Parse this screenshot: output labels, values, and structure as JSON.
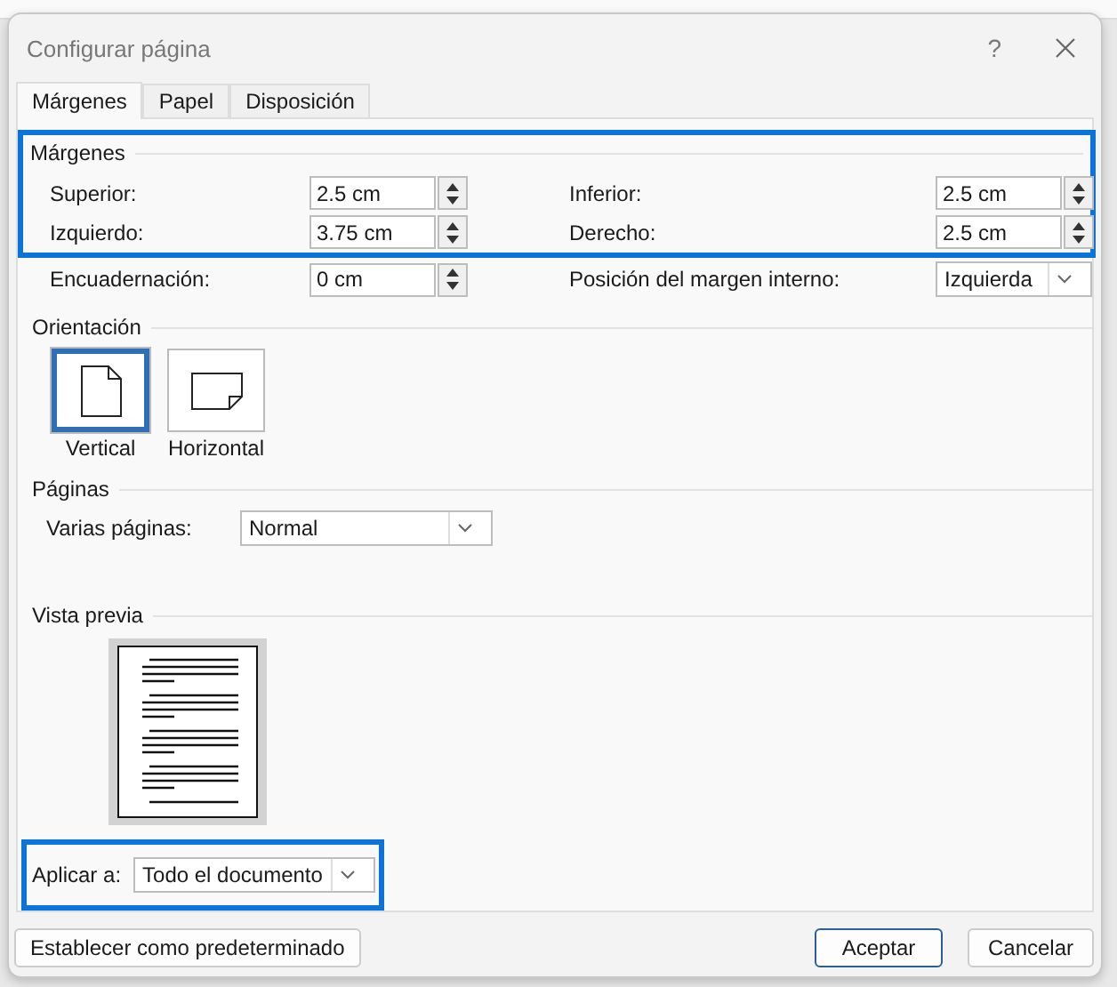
{
  "window": {
    "title": "Configurar página",
    "help": "?"
  },
  "tabs": [
    {
      "label": "Márgenes",
      "selected": true
    },
    {
      "label": "Papel",
      "selected": false
    },
    {
      "label": "Disposición",
      "selected": false
    }
  ],
  "margins": {
    "title": "Márgenes",
    "highlighted": true,
    "fields": [
      {
        "label": "Superior:",
        "value": "2.5 cm"
      },
      {
        "label": "Inferior:",
        "value": "2.5 cm"
      },
      {
        "label": "Izquierdo:",
        "value": "3.75 cm"
      },
      {
        "label": "Derecho:",
        "value": "2.5 cm"
      }
    ]
  },
  "gutter": {
    "label": "Encuadernación:",
    "value": "0 cm"
  },
  "gutter_position": {
    "label": "Posición del margen interno:",
    "value": "Izquierda"
  },
  "orientation": {
    "title": "Orientación",
    "options": [
      {
        "label": "Vertical",
        "kind": "portrait",
        "selected": true
      },
      {
        "label": "Horizontal",
        "kind": "landscape",
        "selected": false
      }
    ]
  },
  "pages": {
    "title": "Páginas",
    "label": "Varias páginas:",
    "value": "Normal"
  },
  "preview": {
    "title": "Vista previa"
  },
  "apply_to": {
    "label": "Aplicar a:",
    "value": "Todo el documento",
    "highlighted": true
  },
  "buttons": [
    {
      "label": "Establecer como predeterminado",
      "kind": "secondary"
    },
    {
      "label": "Aceptar",
      "kind": "default"
    },
    {
      "label": "Cancelar",
      "kind": "secondary"
    }
  ]
}
